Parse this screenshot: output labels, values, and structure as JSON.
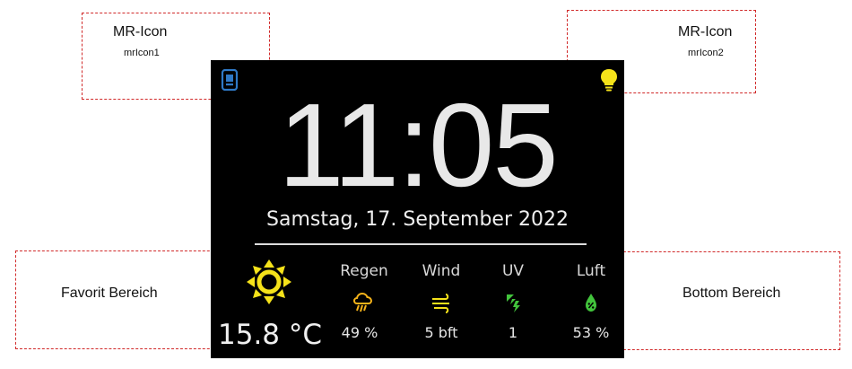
{
  "annotations": {
    "mr_icon_1": {
      "title": "MR-Icon",
      "id": "mrIcon1"
    },
    "mr_icon_2": {
      "title": "MR-Icon",
      "id": "mrIcon2"
    },
    "favorit": "Favorit Bereich",
    "bottom": "Bottom Bereich"
  },
  "display": {
    "time": "11:05",
    "date": "Samstag, 17. September 2022",
    "temperature": "15.8 °C",
    "icons": {
      "left": "phone-icon",
      "right": "lightbulb-icon",
      "favorite": "sun-icon"
    },
    "weather": [
      {
        "label": "Regen",
        "icon": "rain-icon",
        "value": "49 %"
      },
      {
        "label": "Wind",
        "icon": "wind-icon",
        "value": "5 bft"
      },
      {
        "label": "UV",
        "icon": "uv-icon",
        "value": "1"
      },
      {
        "label": "Luft",
        "icon": "humidity-icon",
        "value": "53 %"
      }
    ],
    "colors": {
      "accent_yellow": "#f5e21a",
      "icon_blue": "#2f79c6",
      "icon_green": "#42c43c",
      "background": "#000000"
    }
  }
}
